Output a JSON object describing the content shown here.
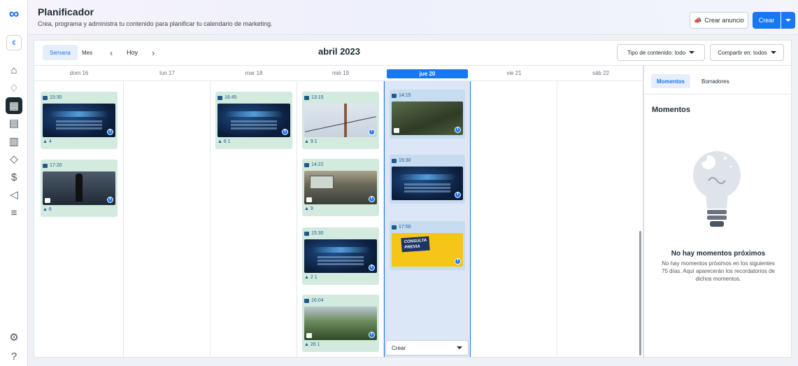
{
  "rail": {
    "items": [
      "meta-logo-icon",
      "page-avatar-icon",
      "home-icon",
      "notifications-icon",
      "planner-icon",
      "content-icon",
      "insights-icon",
      "engagement-icon",
      "monetization-icon",
      "ads-icon",
      "menu-icon",
      "settings-icon",
      "help-icon"
    ],
    "active": "planner-icon"
  },
  "header": {
    "title": "Planificador",
    "subtitle": "Crea, programa y administra tu contenido para planificar tu calendario de marketing.",
    "create_ad_label": "Crear anuncio",
    "create_label": "Crear"
  },
  "toolbar": {
    "week_label": "Semana",
    "month_label": "Mes",
    "today_label": "Hoy",
    "month_title": "abril 2023",
    "content_type_label": "Tipo de contenido: todo",
    "share_label": "Compartir en: todos"
  },
  "days": [
    {
      "label": "dom 16"
    },
    {
      "label": "lun 17"
    },
    {
      "label": "mar 18"
    },
    {
      "label": "mié 19"
    },
    {
      "label": "jue 20"
    },
    {
      "label": "vie 21"
    },
    {
      "label": "sáb 22"
    }
  ],
  "today_index": 4,
  "posts": {
    "sun_1": {
      "time": "15:30",
      "stats": "4"
    },
    "sun_2": {
      "time": "17:20",
      "stats": "6"
    },
    "tue_1": {
      "time": "16:45",
      "stats": "6   1"
    },
    "wed_1": {
      "time": "13:15",
      "stats": "9   1"
    },
    "wed_2": {
      "time": "14:22",
      "stats": "9"
    },
    "wed_3": {
      "time": "15:30",
      "stats": "2   1"
    },
    "wed_4": {
      "time": "16:04",
      "stats": "26   1"
    },
    "thu_1": {
      "time": "14:15"
    },
    "thu_2": {
      "time": "15:30"
    },
    "thu_3": {
      "time": "17:50",
      "badge_line1": "CONSULTA",
      "badge_line2": "PREVIA"
    }
  },
  "crear_dropdown": "Crear",
  "panel": {
    "tab_moments": "Momentos",
    "tab_drafts": "Borradores",
    "heading": "Momentos",
    "empty_title": "No hay momentos próximos",
    "empty_text": "No hay momentos próximos en los siguientes 75 días. Aquí aparecerán los recordatorios de dichos momentos."
  },
  "colors": {
    "accent": "#1877f2",
    "post_bg": "#d3ebdf",
    "today_bg": "#dbe7f6"
  }
}
